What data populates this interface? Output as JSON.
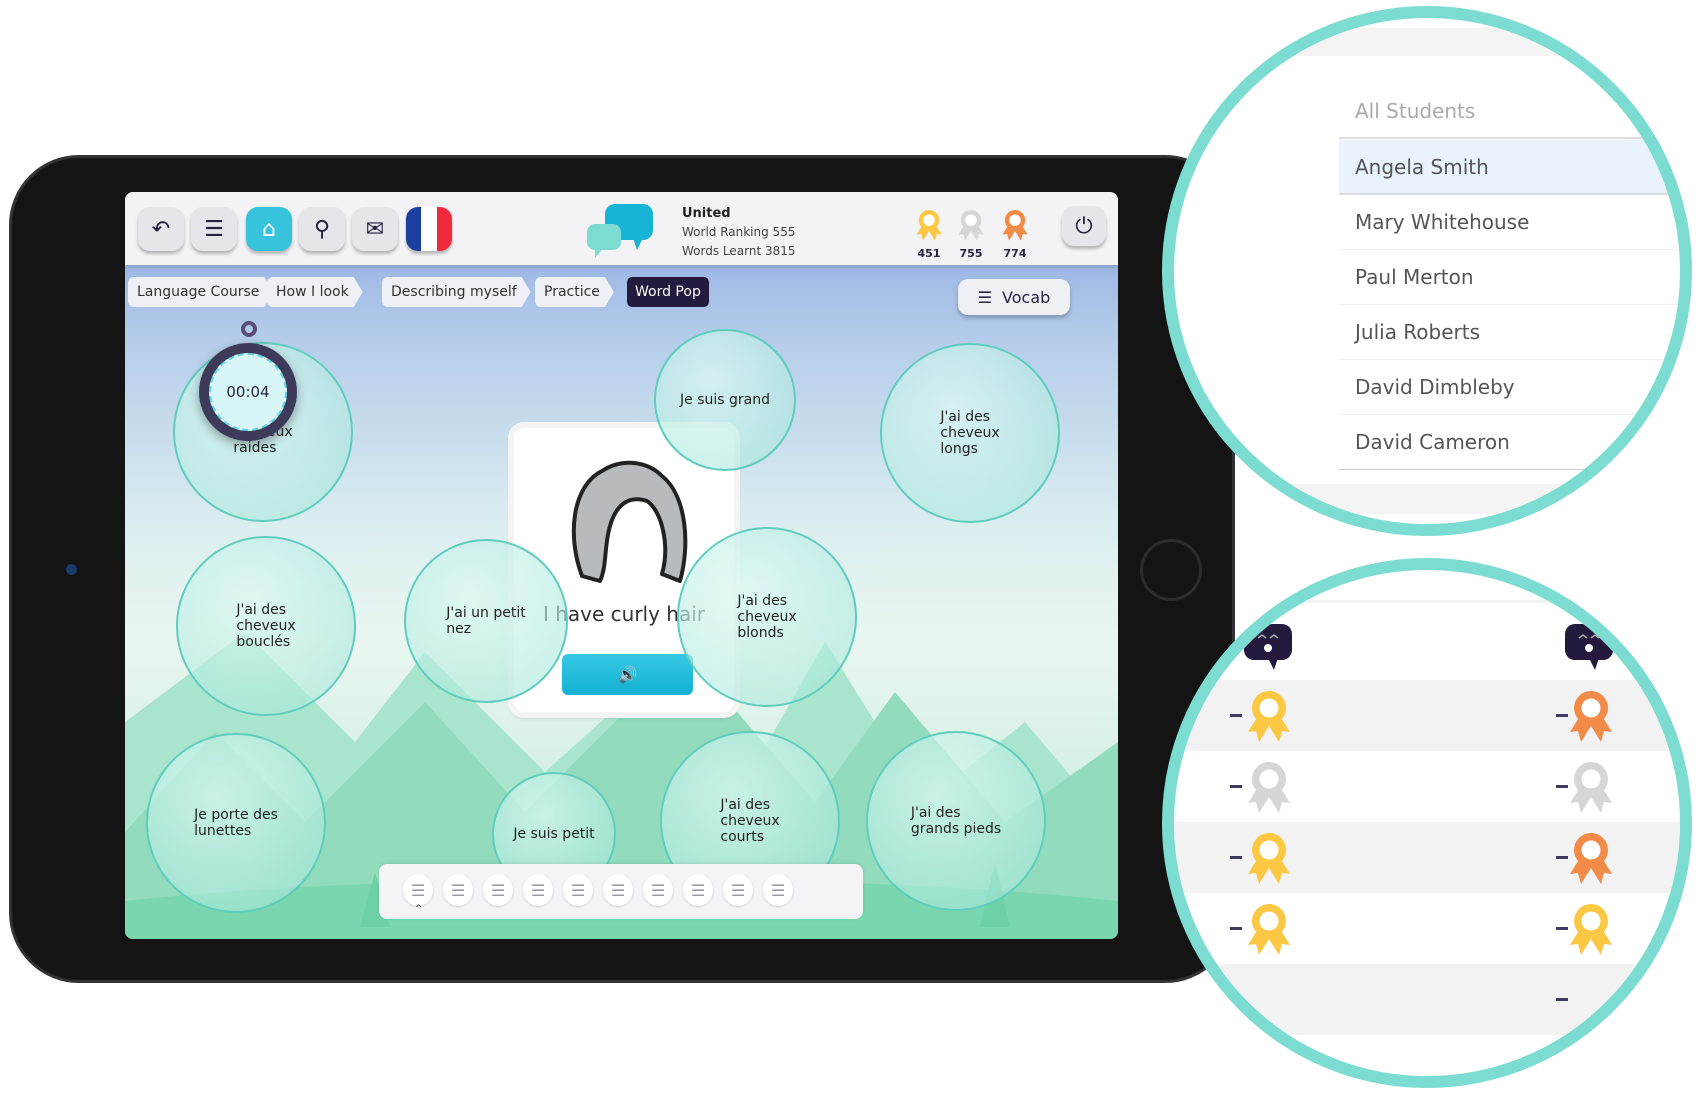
{
  "header": {
    "buttons": [
      {
        "icon": "undo-icon",
        "glyph": "↶"
      },
      {
        "icon": "menu-icon",
        "glyph": "☰"
      },
      {
        "icon": "home-icon",
        "glyph": "⌂"
      },
      {
        "icon": "search-icon",
        "glyph": "⚲"
      },
      {
        "icon": "mail-icon",
        "glyph": "✉"
      }
    ],
    "flag": "france",
    "profile": {
      "name": "United",
      "ranking": "World Ranking 555",
      "words": "Words Learnt 3815"
    },
    "medals": [
      {
        "color": "#fcc844",
        "count": "451"
      },
      {
        "color": "#d6d6d6",
        "count": "755"
      },
      {
        "color": "#f28a48",
        "count": "774"
      }
    ],
    "power_glyph": "⏻"
  },
  "breadcrumbs": [
    "Language Course",
    "How I look",
    "Describing myself",
    "Practice",
    "Word Pop"
  ],
  "vocab": {
    "label": "Vocab",
    "glyph": "☰"
  },
  "timer": "00:04",
  "card": {
    "text": "I have curly hair",
    "sound_glyph": "🔊"
  },
  "bubbles": [
    "J'ai des\ncheveux\nraides",
    "Je suis grand",
    "J'ai des\ncheveux\nlongs",
    "J'ai des\ncheveux\nbouclés",
    "J'ai un petit\nnez",
    "J'ai des\ncheveux\nblonds",
    "Je porte des\nlunettes",
    "Je suis petit",
    "J'ai des\ncheveux\ncourts",
    "J'ai des\ngrands pieds"
  ],
  "tray": {
    "slots": 10,
    "slot_glyph": "☰",
    "caret": "^"
  },
  "students": {
    "header": "All Students",
    "items": [
      "Angela Smith",
      "Mary Whitehouse",
      "Paul Merton",
      "Julia Roberts",
      "David Dimbleby",
      "David Cameron"
    ],
    "selected": "Angela Smith"
  },
  "awards": {
    "left_medals": [
      "#fcc844",
      "#d6d6d6",
      "#fcc844",
      "#fcc844"
    ],
    "right_medals": [
      "#f28a48",
      "#d6d6d6",
      "#f28a48",
      "#fcc844"
    ],
    "dash": "-"
  },
  "colors": {
    "accent": "#37c3dc",
    "zoom_ring": "#7ddcd2",
    "dark": "#241a3e"
  }
}
